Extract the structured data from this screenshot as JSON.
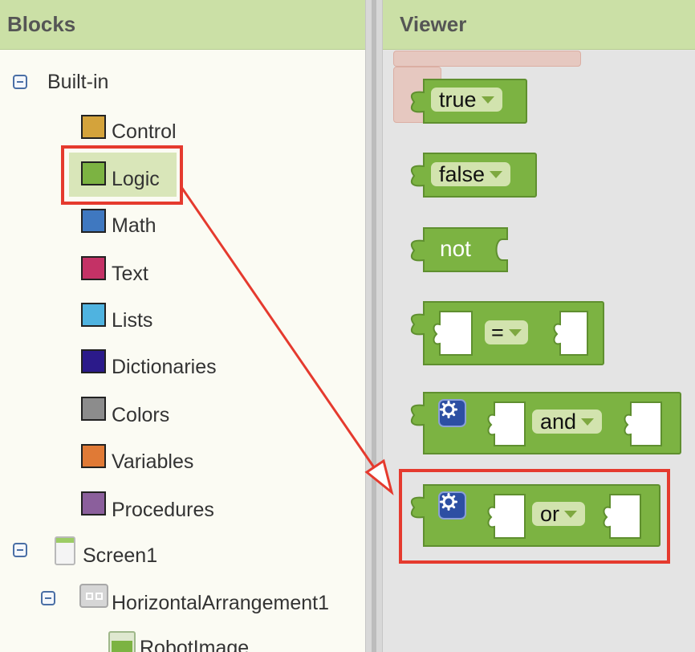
{
  "blocks_panel": {
    "title": "Blocks",
    "builtin_label": "Built-in",
    "categories": [
      {
        "label": "Control",
        "color": "#d4a33b"
      },
      {
        "label": "Logic",
        "color": "#7cb342"
      },
      {
        "label": "Math",
        "color": "#3f78c0"
      },
      {
        "label": "Text",
        "color": "#c43266"
      },
      {
        "label": "Lists",
        "color": "#4fb3e0"
      },
      {
        "label": "Dictionaries",
        "color": "#2b1a8a"
      },
      {
        "label": "Colors",
        "color": "#8c8c8c"
      },
      {
        "label": "Variables",
        "color": "#e07a36"
      },
      {
        "label": "Procedures",
        "color": "#8b5f9c"
      }
    ],
    "selected_category": "Logic",
    "components": {
      "screen": "Screen1",
      "arrangement": "HorizontalArrangement1",
      "image": "RobotImage"
    }
  },
  "viewer": {
    "title": "Viewer",
    "blocks": {
      "true_label": "true",
      "false_label": "false",
      "not_label": "not",
      "eq_label": "=",
      "and_label": "and",
      "or_label": "or"
    }
  },
  "colors": {
    "header_bg": "#cbe0a6",
    "block_green": "#7cb342",
    "annotation_red": "#e53a2e"
  }
}
